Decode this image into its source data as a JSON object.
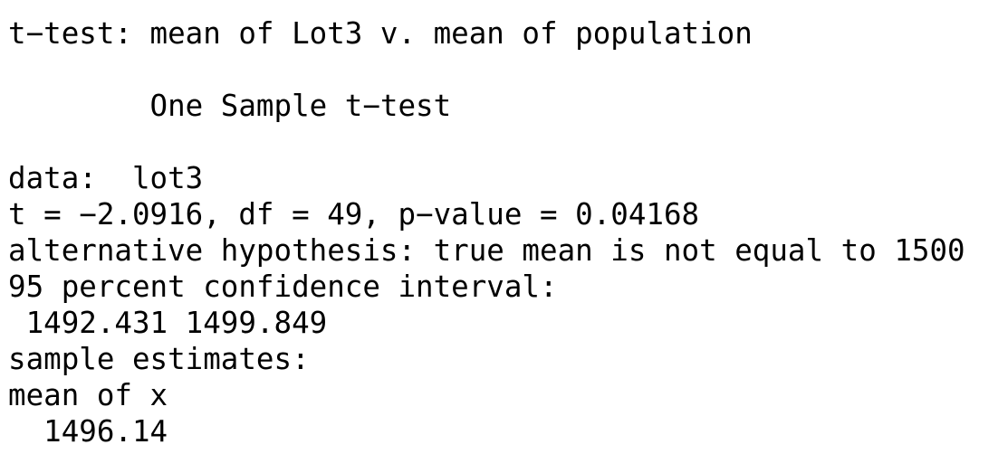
{
  "console": {
    "lines": [
      "t−test: mean of Lot3 v. mean of population",
      "",
      "        One Sample t−test",
      "",
      "data:  lot3",
      "t = −2.0916, df = 49, p−value = 0.04168",
      "alternative hypothesis: true mean is not equal to 1500",
      "95 percent confidence interval:",
      " 1492.431 1499.849",
      "sample estimates:",
      "mean of x",
      "  1496.14"
    ]
  }
}
